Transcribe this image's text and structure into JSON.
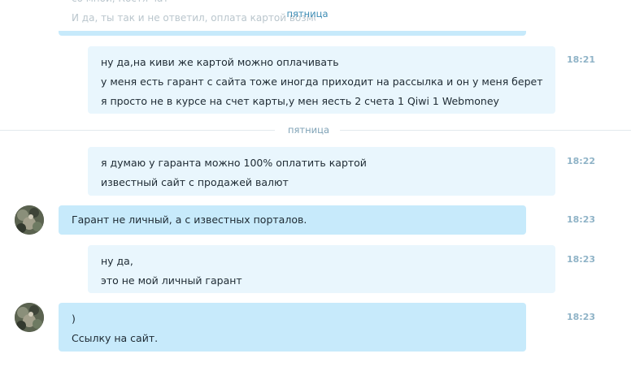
{
  "sticky_day": "пятница",
  "faded_top": {
    "line1": "со мной, Костя чат",
    "line2": "И да, ты так и не ответил, оплата картой возможна?"
  },
  "divider_day": "пятница",
  "messages": [
    {
      "lines": [
        "ну да,на киви же картой можно оплачивать",
        "у меня есть гарант с сайта тоже иногда приходит на рассылка и он у меня берет",
        "я просто не в курсе на счет карты,у мен яесть 2 счета 1 Qiwi 1 Webmoney"
      ],
      "time": "18:21"
    },
    {
      "lines": [
        "я думаю у гаранта  можно 100% оплатить картой",
        "известный сайт с продажей валют"
      ],
      "time": "18:22"
    },
    {
      "lines": [
        "Гарант не личный, а с известных порталов."
      ],
      "time": "18:23"
    },
    {
      "lines": [
        "ну да,",
        "это не мой личный гарант"
      ],
      "time": "18:23"
    },
    {
      "lines": [
        ")",
        "Ссылку на сайт."
      ],
      "time": "18:23"
    }
  ],
  "colors": {
    "outgoing_bubble": "#e9f6fd",
    "incoming_bubble": "#c7eafb",
    "timestamp": "#8fb3c7",
    "day_label": "#7fa2b6"
  },
  "icons": {
    "avatar": "contact-avatar-photo"
  }
}
